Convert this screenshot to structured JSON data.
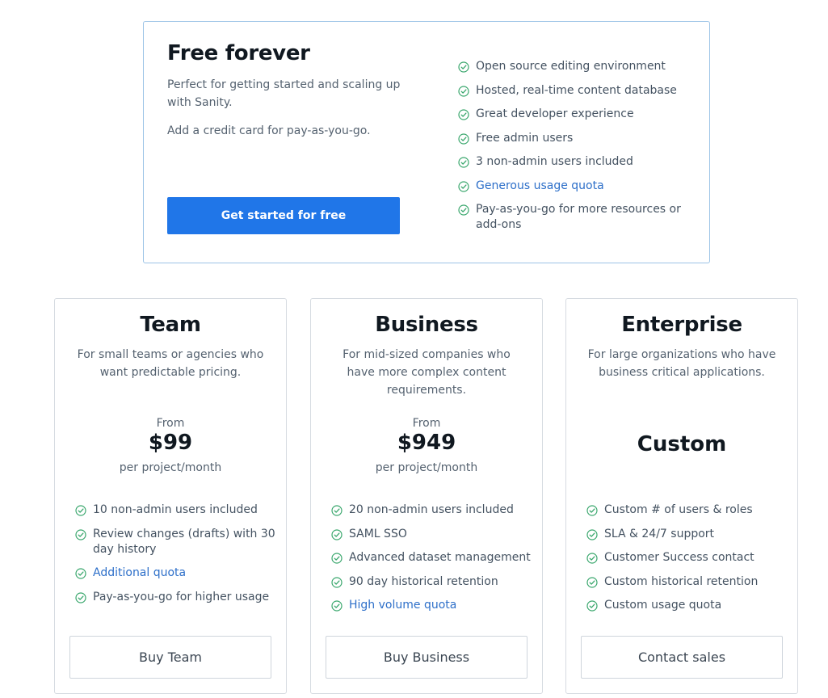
{
  "colors": {
    "accent": "#2076e8",
    "check": "#3aa76d",
    "link": "#2d6fc9",
    "border_free": "#9cc3e6"
  },
  "free": {
    "title": "Free forever",
    "description": "Perfect for getting started and scaling up with Sanity.",
    "note": "Add a credit card for pay-as-you-go.",
    "cta_label": "Get started for free",
    "features": [
      {
        "text": "Open source editing environment",
        "link": false
      },
      {
        "text": "Hosted, real-time content database",
        "link": false
      },
      {
        "text": "Great developer experience",
        "link": false
      },
      {
        "text": "Free admin users",
        "link": false
      },
      {
        "text": "3 non-admin users included",
        "link": false
      },
      {
        "text": "Generous usage quota",
        "link": true
      },
      {
        "text": "Pay-as-you-go for more resources or add-ons",
        "link": false
      }
    ]
  },
  "plans": [
    {
      "name": "Team",
      "description": "For small teams or agencies who want predictable pricing.",
      "from_label": "From",
      "price": "$99",
      "per_label": "per project/month",
      "button_label": "Buy Team",
      "features": [
        {
          "text": "10 non-admin users included",
          "link": false
        },
        {
          "text": "Review changes (drafts) with 30 day history",
          "link": false
        },
        {
          "text": "Additional quota",
          "link": true
        },
        {
          "text": "Pay-as-you-go for higher usage",
          "link": false
        }
      ]
    },
    {
      "name": "Business",
      "description": "For mid-sized companies who have more complex content requirements.",
      "from_label": "From",
      "price": "$949",
      "per_label": "per project/month",
      "button_label": "Buy Business",
      "features": [
        {
          "text": "20 non-admin users included",
          "link": false
        },
        {
          "text": "SAML SSO",
          "link": false
        },
        {
          "text": "Advanced dataset management",
          "link": false
        },
        {
          "text": "90 day historical retention",
          "link": false
        },
        {
          "text": "High volume quota",
          "link": true
        }
      ]
    },
    {
      "name": "Enterprise",
      "description": "For large organizations who have business critical applications.",
      "price": "Custom",
      "button_label": "Contact sales",
      "features": [
        {
          "text": "Custom # of users & roles",
          "link": false
        },
        {
          "text": "SLA & 24/7 support",
          "link": false
        },
        {
          "text": "Customer Success contact",
          "link": false
        },
        {
          "text": "Custom historical retention",
          "link": false
        },
        {
          "text": "Custom usage quota",
          "link": false
        }
      ]
    }
  ]
}
